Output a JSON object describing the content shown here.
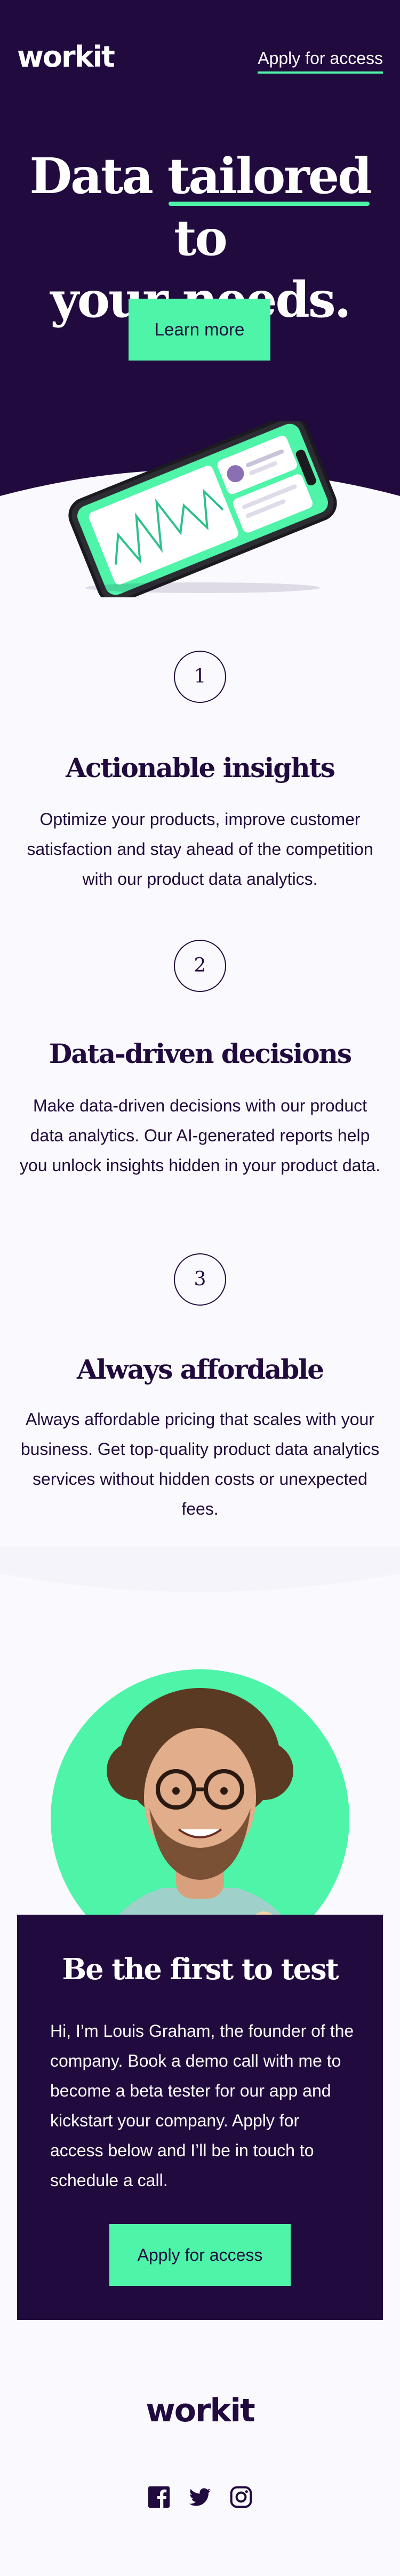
{
  "header": {
    "logo": "workit",
    "nav_link": "Apply for access"
  },
  "hero": {
    "title_part1": "Data ",
    "title_highlight": "tailored",
    "title_part2": " to",
    "title_line2": "your needs.",
    "cta": "Learn more"
  },
  "features": [
    {
      "number": "1",
      "title": "Actionable insights",
      "text": "Optimize your products, improve customer satisfaction and stay ahead of the competition with our product data analytics."
    },
    {
      "number": "2",
      "title": "Data-driven decisions",
      "text": "Make data-driven decisions with our product data analytics. Our AI-generated reports help you unlock insights hidden in your product data."
    },
    {
      "number": "3",
      "title": "Always affordable",
      "text": "Always affordable pricing that scales with your business. Get top-quality product data analytics services without hidden costs or unexpected fees."
    }
  ],
  "founder": {
    "title": "Be the first to test",
    "text": "Hi, I’m Louis Graham, the founder of the company. Book a demo call with me to become a beta tester for our app and kickstart your company. Apply for access below and I’ll be in touch to schedule a call.",
    "cta": "Apply for access"
  },
  "footer": {
    "logo": "workit",
    "social": [
      "facebook-icon",
      "twitter-icon",
      "instagram-icon"
    ]
  },
  "colors": {
    "brand_dark": "#210A3D",
    "accent": "#4EF4A8",
    "background": "#FAF9FE"
  }
}
